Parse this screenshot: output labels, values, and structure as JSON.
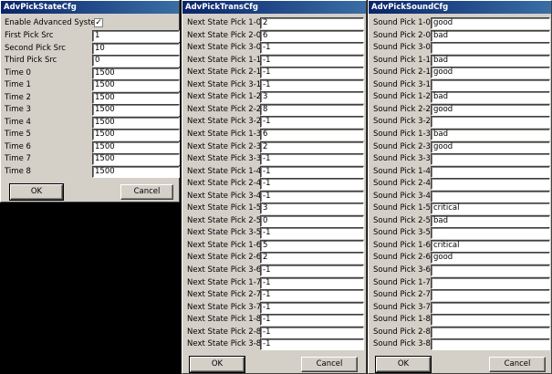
{
  "state": {
    "title": "AdvPickStateCfg",
    "enable_label": "Enable Advanced System",
    "enable_checked": true,
    "fields": [
      {
        "label": "First Pick Src",
        "value": "1"
      },
      {
        "label": "Second Pick Src",
        "value": "10"
      },
      {
        "label": "Third Pick Src",
        "value": "0"
      },
      {
        "label": "Time 0",
        "value": "1500"
      },
      {
        "label": "Time 1",
        "value": "1500"
      },
      {
        "label": "Time 2",
        "value": "1500"
      },
      {
        "label": "Time 3",
        "value": "1500"
      },
      {
        "label": "Time 4",
        "value": "1500"
      },
      {
        "label": "Time 5",
        "value": "1500"
      },
      {
        "label": "Time 6",
        "value": "1500"
      },
      {
        "label": "Time 7",
        "value": "1500"
      },
      {
        "label": "Time 8",
        "value": "1500"
      }
    ],
    "ok_label": "OK",
    "cancel_label": "Cancel"
  },
  "trans": {
    "title": "AdvPickTransCfg",
    "fields": [
      {
        "label": "Next State Pick 1-0",
        "value": "2"
      },
      {
        "label": "Next State Pick 2-0",
        "value": "6"
      },
      {
        "label": "Next State Pick 3-0",
        "value": "-1"
      },
      {
        "label": "Next State Pick 1-1",
        "value": "-1"
      },
      {
        "label": "Next State Pick 2-1",
        "value": "-1"
      },
      {
        "label": "Next State Pick 3-1",
        "value": "-1"
      },
      {
        "label": "Next State Pick 1-2",
        "value": "3"
      },
      {
        "label": "Next State Pick 2-2",
        "value": "8"
      },
      {
        "label": "Next State Pick 3-2",
        "value": "-1"
      },
      {
        "label": "Next State Pick 1-3",
        "value": "6"
      },
      {
        "label": "Next State Pick 2-3",
        "value": "2"
      },
      {
        "label": "Next State Pick 3-3",
        "value": "-1"
      },
      {
        "label": "Next State Pick 1-4",
        "value": "-1"
      },
      {
        "label": "Next State Pick 2-4",
        "value": "-1"
      },
      {
        "label": "Next State Pick 3-4",
        "value": "-1"
      },
      {
        "label": "Next State Pick 1-5",
        "value": "3"
      },
      {
        "label": "Next State Pick 2-5",
        "value": "0"
      },
      {
        "label": "Next State Pick 3-5",
        "value": "-1"
      },
      {
        "label": "Next State Pick 1-6",
        "value": "5"
      },
      {
        "label": "Next State Pick 2-6",
        "value": "2"
      },
      {
        "label": "Next State Pick 3-6",
        "value": "-1"
      },
      {
        "label": "Next State Pick 1-7",
        "value": "-1"
      },
      {
        "label": "Next State Pick 2-7",
        "value": "-1"
      },
      {
        "label": "Next State Pick 3-7",
        "value": "-1"
      },
      {
        "label": "Next State Pick 1-8",
        "value": "-1"
      },
      {
        "label": "Next State Pick 2-8",
        "value": "-1"
      },
      {
        "label": "Next State Pick 3-8",
        "value": "-1"
      }
    ],
    "ok_label": "OK",
    "cancel_label": "Cancel"
  },
  "sound": {
    "title": "AdvPickSoundCfg",
    "fields": [
      {
        "label": "Sound Pick 1-0",
        "value": "good"
      },
      {
        "label": "Sound Pick 2-0",
        "value": "bad"
      },
      {
        "label": "Sound Pick 3-0",
        "value": ""
      },
      {
        "label": "Sound Pick 1-1",
        "value": "bad"
      },
      {
        "label": "Sound Pick 2-1",
        "value": "good"
      },
      {
        "label": "Sound Pick 3-1",
        "value": ""
      },
      {
        "label": "Sound Pick 1-2",
        "value": "bad"
      },
      {
        "label": "Sound Pick 2-2",
        "value": "good"
      },
      {
        "label": "Sound Pick 3-2",
        "value": ""
      },
      {
        "label": "Sound Pick 1-3",
        "value": "bad"
      },
      {
        "label": "Sound Pick 2-3",
        "value": "good"
      },
      {
        "label": "Sound Pick 3-3",
        "value": ""
      },
      {
        "label": "Sound Pick 1-4",
        "value": ""
      },
      {
        "label": "Sound Pick 2-4",
        "value": ""
      },
      {
        "label": "Sound Pick 3-4",
        "value": ""
      },
      {
        "label": "Sound Pick 1-5",
        "value": "critical"
      },
      {
        "label": "Sound Pick 2-5",
        "value": "bad"
      },
      {
        "label": "Sound Pick 3-5",
        "value": ""
      },
      {
        "label": "Sound Pick 1-6",
        "value": "critical"
      },
      {
        "label": "Sound Pick 2-6",
        "value": "good"
      },
      {
        "label": "Sound Pick 3-6",
        "value": ""
      },
      {
        "label": "Sound Pick 1-7",
        "value": ""
      },
      {
        "label": "Sound Pick 2-7",
        "value": ""
      },
      {
        "label": "Sound Pick 3-7",
        "value": ""
      },
      {
        "label": "Sound Pick 1-8",
        "value": ""
      },
      {
        "label": "Sound Pick 2-8",
        "value": ""
      },
      {
        "label": "Sound Pick 3-8",
        "value": ""
      }
    ],
    "ok_label": "OK",
    "cancel_label": "Cancel"
  }
}
